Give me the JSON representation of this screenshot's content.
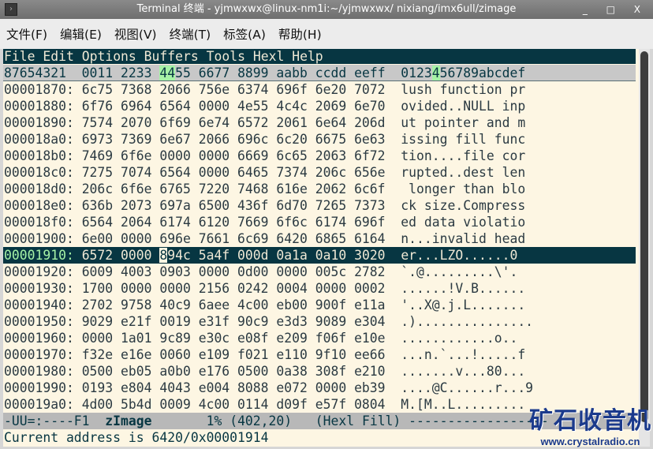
{
  "window": {
    "title": "Terminal 终端 - yjmwxwx@linux-nm1i:~/yjmwxwx/ nixiang/imx6ull/zimage",
    "controls": "_ □ X"
  },
  "app_menu": [
    "文件(F)",
    "编辑(E)",
    "视图(V)",
    "终端(T)",
    "标签(A)",
    "帮助(H)"
  ],
  "emacs_menu": [
    "File",
    "Edit",
    "Options",
    "Buffers",
    "Tools",
    "Hexl",
    "Help"
  ],
  "hex_header": {
    "pre": "87654321  0011 2233 ",
    "hl1": "44",
    "mid": "55 6677 8899 aabb ccdd eeff  0123",
    "hl2": "4",
    "post": "56789abcdef"
  },
  "rows": [
    {
      "addr": "00001870:",
      "hex": "6c75 7368 2066 756e 6374 696f 6e20 7072",
      "ascii": "lush function pr"
    },
    {
      "addr": "00001880:",
      "hex": "6f76 6964 6564 0000 4e55 4c4c 2069 6e70",
      "ascii": "ovided..NULL inp"
    },
    {
      "addr": "00001890:",
      "hex": "7574 2070 6f69 6e74 6572 2061 6e64 206d",
      "ascii": "ut pointer and m"
    },
    {
      "addr": "000018a0:",
      "hex": "6973 7369 6e67 2066 696c 6c20 6675 6e63",
      "ascii": "issing fill func"
    },
    {
      "addr": "000018b0:",
      "hex": "7469 6f6e 0000 0000 6669 6c65 2063 6f72",
      "ascii": "tion....file cor"
    },
    {
      "addr": "000018c0:",
      "hex": "7275 7074 6564 0000 6465 7374 206c 656e",
      "ascii": "rupted..dest len"
    },
    {
      "addr": "000018d0:",
      "hex": "206c 6f6e 6765 7220 7468 616e 2062 6c6f",
      "ascii": " longer than blo"
    },
    {
      "addr": "000018e0:",
      "hex": "636b 2073 697a 6500 436f 6d70 7265 7373",
      "ascii": "ck size.Compress"
    },
    {
      "addr": "000018f0:",
      "hex": "6564 2064 6174 6120 7669 6f6c 6174 696f",
      "ascii": "ed data violatio"
    },
    {
      "addr": "00001900:",
      "hex": "6e00 0000 696e 7661 6c69 6420 6865 6164",
      "ascii": "n...invalid head"
    },
    {
      "addr": "00001910:",
      "hex_pre": "6572 0000 ",
      "cursor": "8",
      "hex_post": "94c 5a4f 000d 0a1a 0a10 3020",
      "ascii": "er...LZO......0",
      "selected": true
    },
    {
      "addr": "00001920:",
      "hex": "6009 4003 0903 0000 0d00 0000 005c 2782",
      "ascii": "`.@.........\\'."
    },
    {
      "addr": "00001930:",
      "hex": "1700 0000 0000 2156 0242 0004 0000 0002",
      "ascii": "......!V.B......"
    },
    {
      "addr": "00001940:",
      "hex": "2702 9758 40c9 6aee 4c00 eb00 900f e11a",
      "ascii": "'..X@.j.L......."
    },
    {
      "addr": "00001950:",
      "hex": "9029 e21f 0019 e31f 90c9 e3d3 9089 e304",
      "ascii": ".)..............."
    },
    {
      "addr": "00001960:",
      "hex": "0000 1a01 9c89 e30c e08f e209 f06f e10e",
      "ascii": "............o.."
    },
    {
      "addr": "00001970:",
      "hex": "f32e e16e 0060 e109 f021 e110 9f10 ee66",
      "ascii": "...n.`...!.....f"
    },
    {
      "addr": "00001980:",
      "hex": "0500 eb05 a0b0 e176 0500 0a38 308f e210",
      "ascii": ".......v...80..."
    },
    {
      "addr": "00001990:",
      "hex": "0193 e804 4043 e004 8088 e072 0000 eb39",
      "ascii": "....@C......r...9"
    },
    {
      "addr": "000019a0:",
      "hex": "4d00 5b4d 0009 4c00 0114 d09f e57f 0804",
      "ascii": "M.[M..L........."
    }
  ],
  "modeline": {
    "pre": "-UU=:----F1  ",
    "buffer": "zImage",
    "post": "       1% (402,20)   (Hexl Fill) ------------------"
  },
  "echo": "Current address is 6420/0x00001914",
  "watermark": {
    "title": "矿石收音机",
    "url": "www.crystalradio.cn"
  }
}
